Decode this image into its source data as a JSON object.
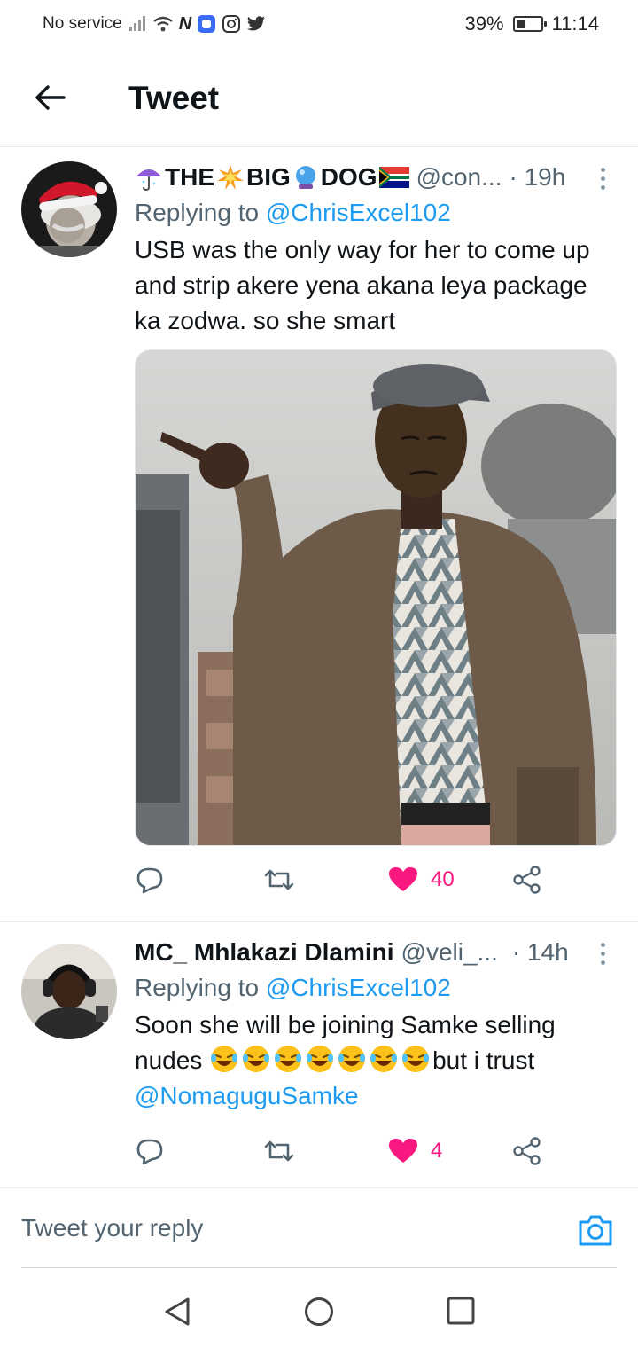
{
  "status_bar": {
    "carrier": "No service",
    "battery": "39%",
    "battery_level": 0.39,
    "time": "11:14"
  },
  "header": {
    "title": "Tweet"
  },
  "tweets": [
    {
      "display_name_parts": [
        "THE",
        "BIG",
        "DOG"
      ],
      "handle": "@con...",
      "time": "· 19h",
      "replying_label": "Replying to",
      "replying_to": "@ChrisExcel102",
      "text": "USB was the only way for her to come up and strip akere yena akana leya package ka zodwa. so she smart",
      "likes": "40",
      "has_media": true
    },
    {
      "display_name": "MC_ Mhlakazi Dlamini",
      "handle": "@veli_...",
      "time": "· 14h",
      "replying_label": "Replying to",
      "replying_to": "@ChrisExcel102",
      "text_before": "Soon she will be joining Samke selling nudes ",
      "text_after": "but i trust",
      "mention_end": "@NomaguguSamke",
      "likes": "4"
    }
  ],
  "reply_bar": {
    "placeholder": "Tweet your reply"
  },
  "colors": {
    "accent": "#1d9bf0",
    "like": "#f91880",
    "secondary_text": "#536471"
  }
}
